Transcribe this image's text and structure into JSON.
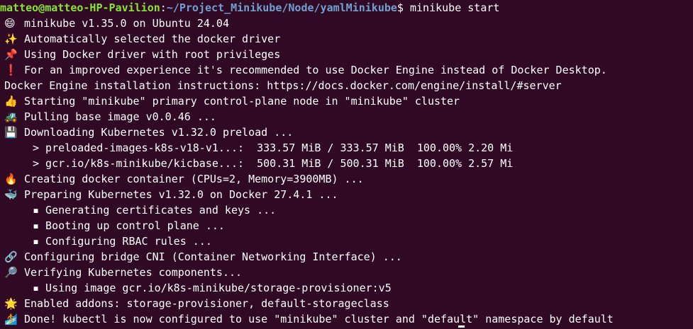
{
  "prompt": {
    "user_host": "matteo@matteo-HP-Pavilion",
    "separator": ":",
    "path": "~/Project_Minikube/Node/yamlMinikube",
    "symbol": "$",
    "command": " minikube start"
  },
  "lines": [
    {
      "icon": "😄",
      "icon_name": "grinning-face-icon",
      "text": "minikube v1.35.0 on Ubuntu 24.04"
    },
    {
      "icon": "✨",
      "icon_name": "sparkles-icon",
      "text": "Automatically selected the docker driver"
    },
    {
      "icon": "📌",
      "icon_name": "pushpin-icon",
      "text": "Using Docker driver with root privileges"
    },
    {
      "icon": "❗",
      "icon_name": "exclamation-icon",
      "text": "For an improved experience it's recommended to use Docker Engine instead of Docker Desktop."
    },
    {
      "icon": "",
      "icon_name": "",
      "text": "Docker Engine installation instructions: https://docs.docker.com/engine/install/#server"
    },
    {
      "icon": "👍",
      "icon_name": "thumbs-up-icon",
      "text": "Starting \"minikube\" primary control-plane node in \"minikube\" cluster"
    },
    {
      "icon": "🚜",
      "icon_name": "tractor-icon",
      "text": "Pulling base image v0.0.46 ..."
    },
    {
      "icon": "💾",
      "icon_name": "floppy-disk-icon",
      "text": "Downloading Kubernetes v1.32.0 preload ..."
    },
    {
      "icon": "",
      "icon_name": "",
      "text": "> preloaded-images-k8s-v18-v1...:  333.57 MiB / 333.57 MiB  100.00% 2.20 Mi"
    },
    {
      "icon": "",
      "icon_name": "",
      "text": "> gcr.io/k8s-minikube/kicbase...:  500.31 MiB / 500.31 MiB  100.00% 2.57 Mi"
    },
    {
      "icon": "🔥",
      "icon_name": "fire-icon",
      "text": "Creating docker container (CPUs=2, Memory=3900MB) ..."
    },
    {
      "icon": "🐳",
      "icon_name": "whale-icon",
      "text": "Preparing Kubernetes v1.32.0 on Docker 27.4.1 ..."
    },
    {
      "icon": "",
      "icon_name": "",
      "text": "▪ Generating certificates and keys ..."
    },
    {
      "icon": "",
      "icon_name": "",
      "text": "▪ Booting up control plane ..."
    },
    {
      "icon": "",
      "icon_name": "",
      "text": "▪ Configuring RBAC rules ..."
    },
    {
      "icon": "🔗",
      "icon_name": "link-icon",
      "text": "Configuring bridge CNI (Container Networking Interface) ..."
    },
    {
      "icon": "🔎",
      "icon_name": "magnifying-glass-icon",
      "text": "Verifying Kubernetes components..."
    },
    {
      "icon": "",
      "icon_name": "",
      "text": "▪ Using image gcr.io/k8s-minikube/storage-provisioner:v5"
    },
    {
      "icon": "🌟",
      "icon_name": "glowing-star-icon",
      "text": "Enabled addons: storage-provisioner, default-storageclass"
    },
    {
      "icon": "🏄",
      "icon_name": "surfer-icon",
      "text": "Done! kubectl is now configured to use \"minikube\" cluster and \"default\" namespace by default"
    }
  ],
  "colors": {
    "background": "#300a24",
    "foreground": "#ffffff",
    "user_host": "#8ae234",
    "path": "#729fcf"
  }
}
